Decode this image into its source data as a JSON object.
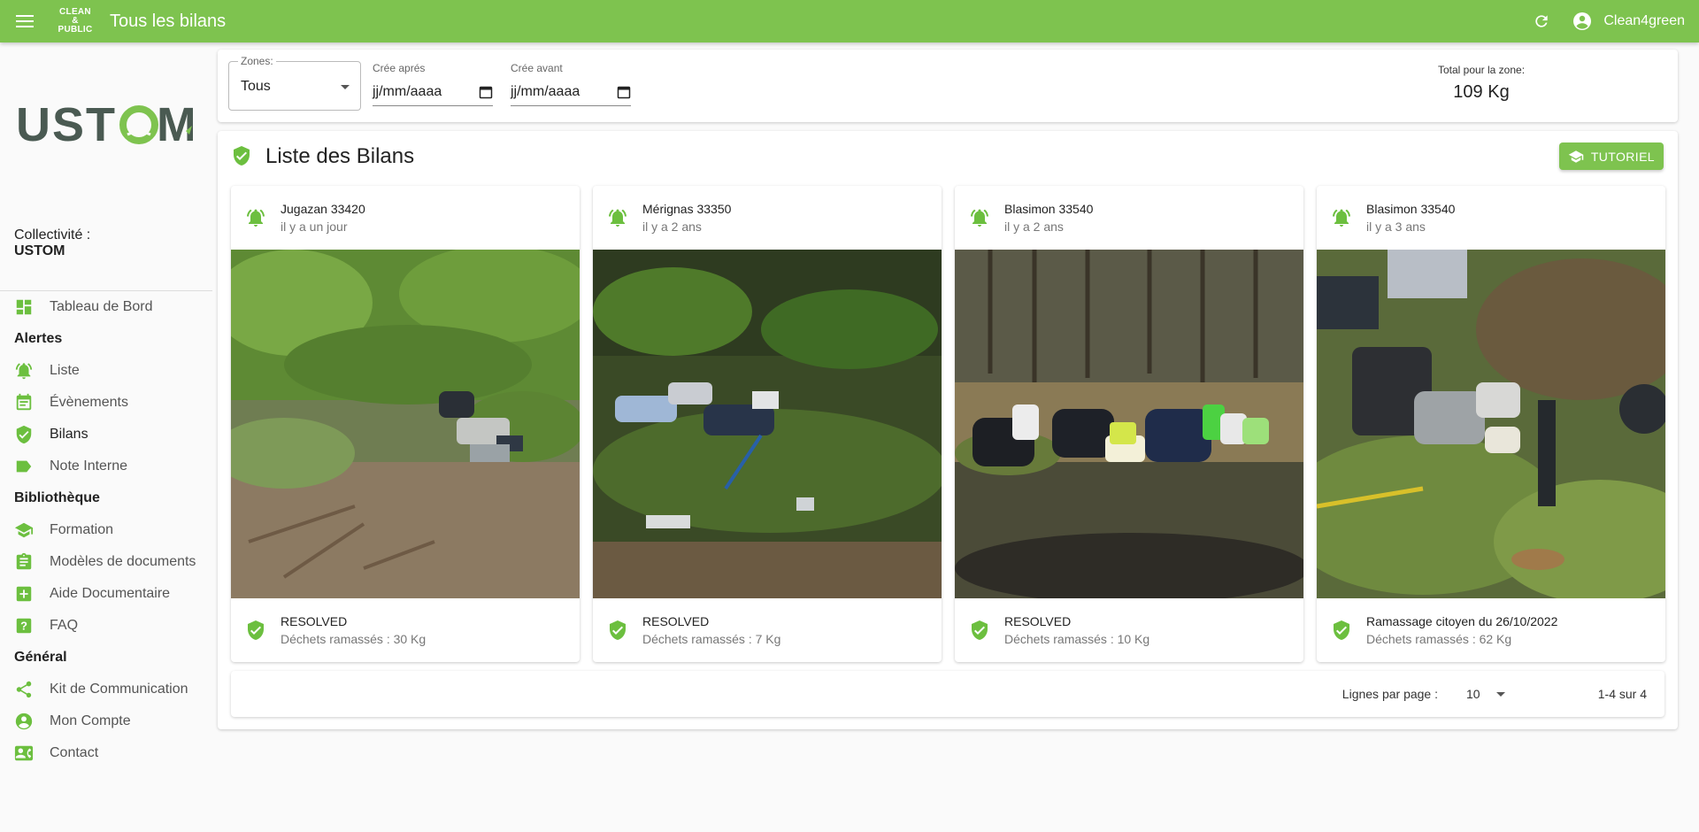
{
  "appbar": {
    "title": "Tous les bilans",
    "logo_lines": [
      "CLEAN",
      "&",
      "PUBLIC"
    ],
    "user": "Clean4green"
  },
  "sidebar": {
    "brand": "USTOM",
    "collectivite_label": "Collectivité :",
    "collectivite_value": "USTOM",
    "dashboard": "Tableau de Bord",
    "sections": {
      "alertes": "Alertes",
      "bibliotheque": "Bibliothèque",
      "general": "Général"
    },
    "alertes_items": [
      "Liste",
      "Évènements",
      "Bilans",
      "Note Interne"
    ],
    "bibliotheque_items": [
      "Formation",
      "Modèles de documents",
      "Aide Documentaire",
      "FAQ"
    ],
    "general_items": [
      "Kit de Communication",
      "Mon Compte",
      "Contact"
    ]
  },
  "filters": {
    "zone_label": "Zones:",
    "zone_value": "Tous",
    "after_label": "Crée aprés",
    "after_value": "jj/mm/aaaa",
    "before_label": "Crée avant",
    "before_value": "jj/mm/aaaa",
    "total_label": "Total pour la zone:",
    "total_value": "109 Kg"
  },
  "list": {
    "title": "Liste des Bilans",
    "tutorial_button": "TUTORIEL"
  },
  "cards": [
    {
      "location": "Jugazan 33420",
      "time": "il y a un jour",
      "status": "RESOLVED",
      "waste": "Déchets ramassés : 30 Kg"
    },
    {
      "location": "Mérignas 33350",
      "time": "il y a 2 ans",
      "status": "RESOLVED",
      "waste": "Déchets ramassés : 7 Kg"
    },
    {
      "location": "Blasimon 33540",
      "time": "il y a 2 ans",
      "status": "RESOLVED",
      "waste": "Déchets ramassés : 10 Kg"
    },
    {
      "location": "Blasimon 33540",
      "time": "il y a 3 ans",
      "status": "Ramassage citoyen du 26/10/2022",
      "waste": "Déchets ramassés : 62 Kg"
    }
  ],
  "pagination": {
    "rows_label": "Lignes par page :",
    "rows_value": "10",
    "range": "1-4 sur 4"
  },
  "colors": {
    "accent": "#7ec34f",
    "icon_green": "#6cbf3f",
    "brand_dark": "#4a5a52"
  }
}
